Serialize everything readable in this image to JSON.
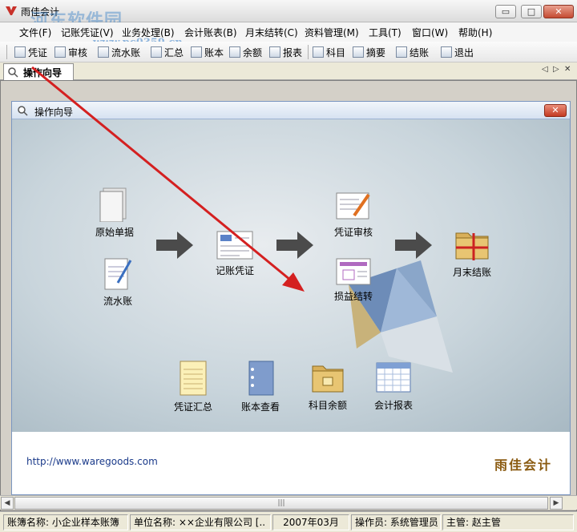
{
  "window": {
    "title": "雨佳会计",
    "minimize": "▭",
    "maximize": "□",
    "close": "✕"
  },
  "watermark": {
    "main": "河东软件园",
    "sub": "www.pc0359.cn"
  },
  "menu": [
    "文件(F)",
    "记账凭证(V)",
    "业务处理(B)",
    "会计账表(B)",
    "月末结转(C)",
    "资料管理(M)",
    "工具(T)",
    "窗口(W)",
    "帮助(H)"
  ],
  "toolbar": [
    "凭证",
    "审核",
    "流水账",
    "汇总",
    "账本",
    "余额",
    "报表",
    "科目",
    "摘要",
    "结账",
    "退出"
  ],
  "tab": {
    "label": "操作向导",
    "scroll_left": "◁",
    "scroll_right": "▷",
    "close": "✕"
  },
  "child": {
    "title": "操作向导",
    "close": "✕"
  },
  "nodes": {
    "original_docs": "原始单据",
    "cashbook": "流水账",
    "voucher": "记账凭证",
    "voucher_audit": "凭证审核",
    "profit_loss": "损益结转",
    "month_end": "月末结账",
    "voucher_summary": "凭证汇总",
    "ledger_view": "账本查看",
    "account_balance": "科目余额",
    "reports": "会计报表"
  },
  "footer": {
    "url": "http://www.waregoods.com",
    "brand": "雨佳会计"
  },
  "hscroll": {
    "left": "◀",
    "right": "▶",
    "thumb": "|||"
  },
  "status": {
    "book": "账簿名称: 小企业样本账簿",
    "unit": "单位名称: ××企业有限公司 [..",
    "period": "2007年03月",
    "operator": "操作员: 系统管理员",
    "supervisor": "主管: 赵主管"
  },
  "colors": {
    "accent_red": "#d42020",
    "brand": "#8a5a10",
    "link": "#1a3a8a"
  }
}
